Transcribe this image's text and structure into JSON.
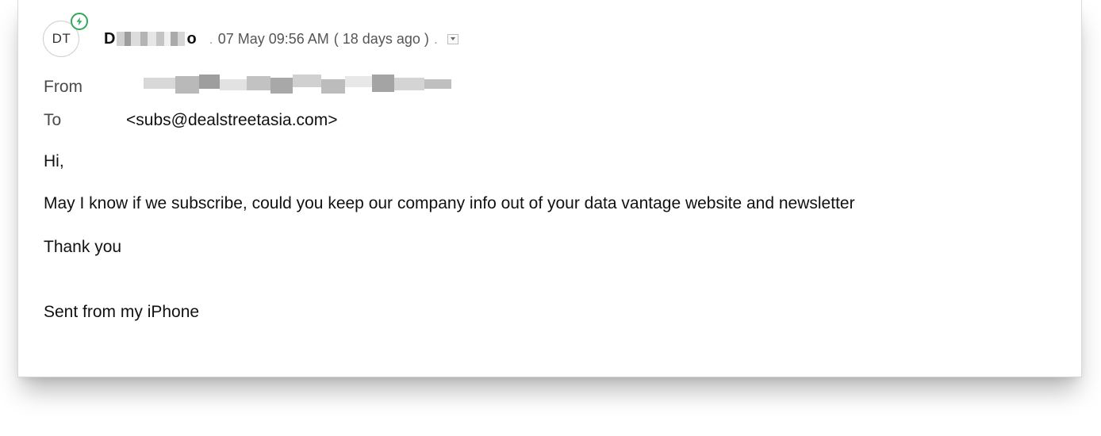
{
  "sender": {
    "initials": "DT",
    "name_first": "D",
    "name_last": "o",
    "date": "07 May 09:56 AM",
    "relative": "( 18 days ago )"
  },
  "from": {
    "label": "From"
  },
  "to": {
    "label": "To",
    "value": "<subs@dealstreetasia.com>"
  },
  "body": {
    "greeting": "Hi,",
    "message": "May I know if we subscribe, could you keep our company info out of your data vantage website and newsletter",
    "closing": "Thank you",
    "signature": "Sent from my iPhone"
  },
  "colors": {
    "badge": "#2eaa57",
    "text": "#111111",
    "muted": "#555555"
  },
  "icons": [
    "lightning-icon",
    "chevron-down-icon"
  ]
}
